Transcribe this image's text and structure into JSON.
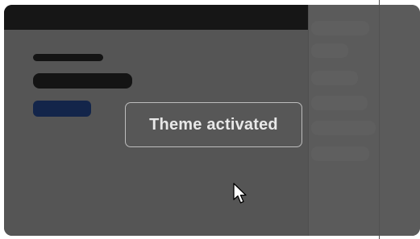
{
  "toast": {
    "message": "Theme activated"
  },
  "icons": {
    "cursor": "mouse-pointer-arrow-icon"
  },
  "colors": {
    "window_background": "#555555",
    "topbar": "#161616",
    "skeleton": "#141414",
    "skeleton_accent": "#13254a",
    "toast_border": "#bdbdbd",
    "toast_text": "#e8e8e8"
  }
}
